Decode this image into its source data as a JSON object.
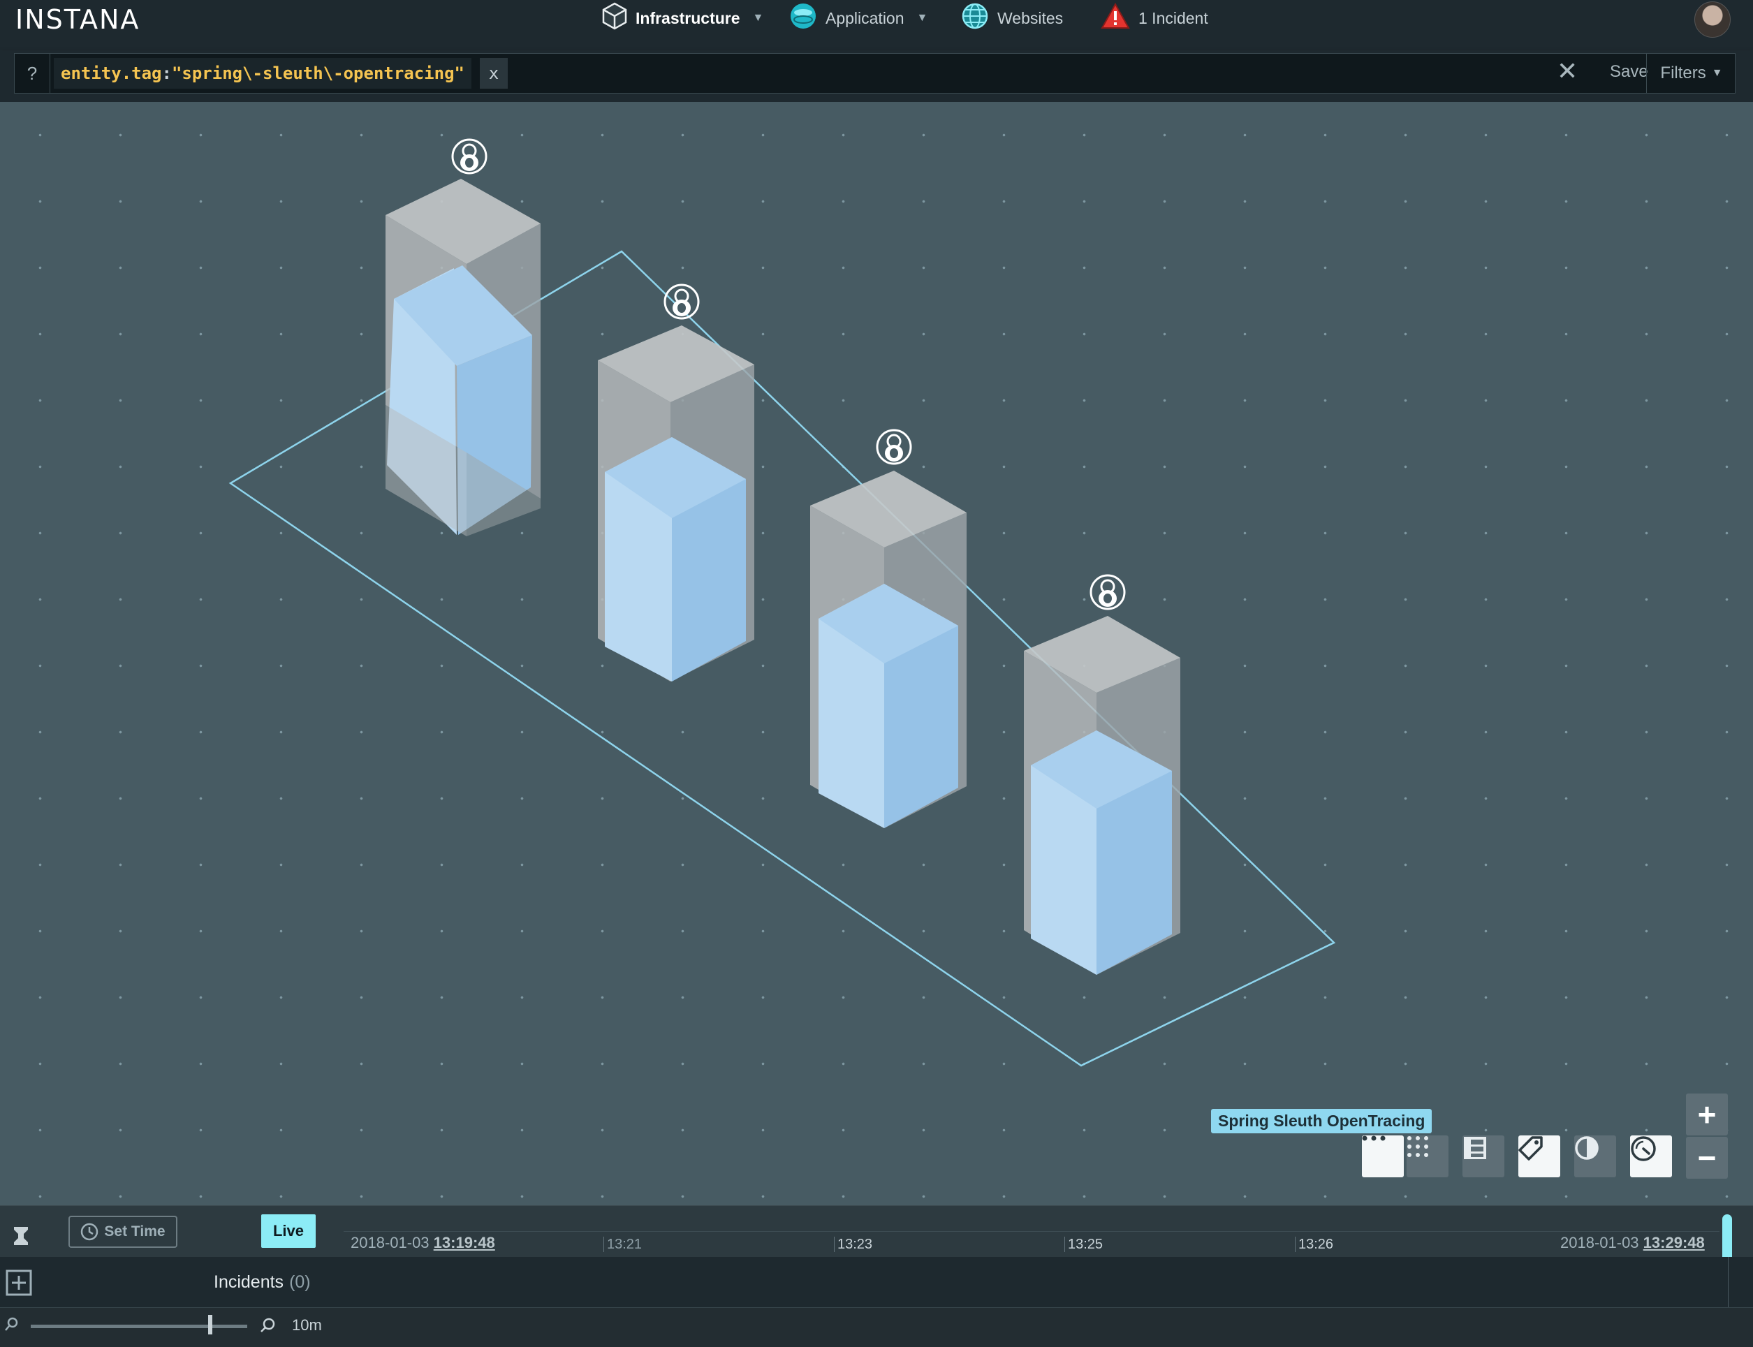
{
  "app": {
    "logo": "INSTANA"
  },
  "nav": {
    "items": [
      {
        "label": "Infrastructure",
        "icon": "cube-icon",
        "has_dropdown": true,
        "active": true
      },
      {
        "label": "Application",
        "icon": "database-icon",
        "has_dropdown": true,
        "active": false
      },
      {
        "label": "Websites",
        "icon": "globe-icon",
        "has_dropdown": false,
        "active": false
      },
      {
        "label": "1 Incident",
        "icon": "warning-icon",
        "has_dropdown": false,
        "active": false
      }
    ]
  },
  "filter": {
    "help": "?",
    "query_key": "entity.tag",
    "query_colon": ":",
    "query_value": "\"spring\\-sleuth\\-opentracing\"",
    "chip_remove": "x",
    "save_label": "Save",
    "filters_label": "Filters"
  },
  "map": {
    "zone_label": "Spring Sleuth OpenTracing",
    "hosts": [
      {
        "os_icon": "linux-penguin-icon"
      },
      {
        "os_icon": "linux-penguin-icon"
      },
      {
        "os_icon": "linux-penguin-icon"
      },
      {
        "os_icon": "linux-penguin-icon"
      }
    ],
    "controls": [
      "more-icon",
      "grid-icon",
      "layout-icon",
      "tag-icon",
      "pie-icon",
      "gauge-icon"
    ],
    "zoom": [
      "+",
      "−"
    ]
  },
  "timeline": {
    "set_time_label": "Set Time",
    "live_label": "Live",
    "start_date": "2018-01-03",
    "start_time": "13:19:48",
    "end_date": "2018-01-03",
    "end_time": "13:29:48",
    "ticks": [
      "13:21",
      "13:23",
      "13:25",
      "13:26"
    ]
  },
  "incidents": {
    "label": "Incidents",
    "count": "(0)"
  },
  "footer": {
    "zoom_window": "10m"
  },
  "colors": {
    "accent": "#8cecf6",
    "query": "#f5c451",
    "background": "#475b63"
  }
}
